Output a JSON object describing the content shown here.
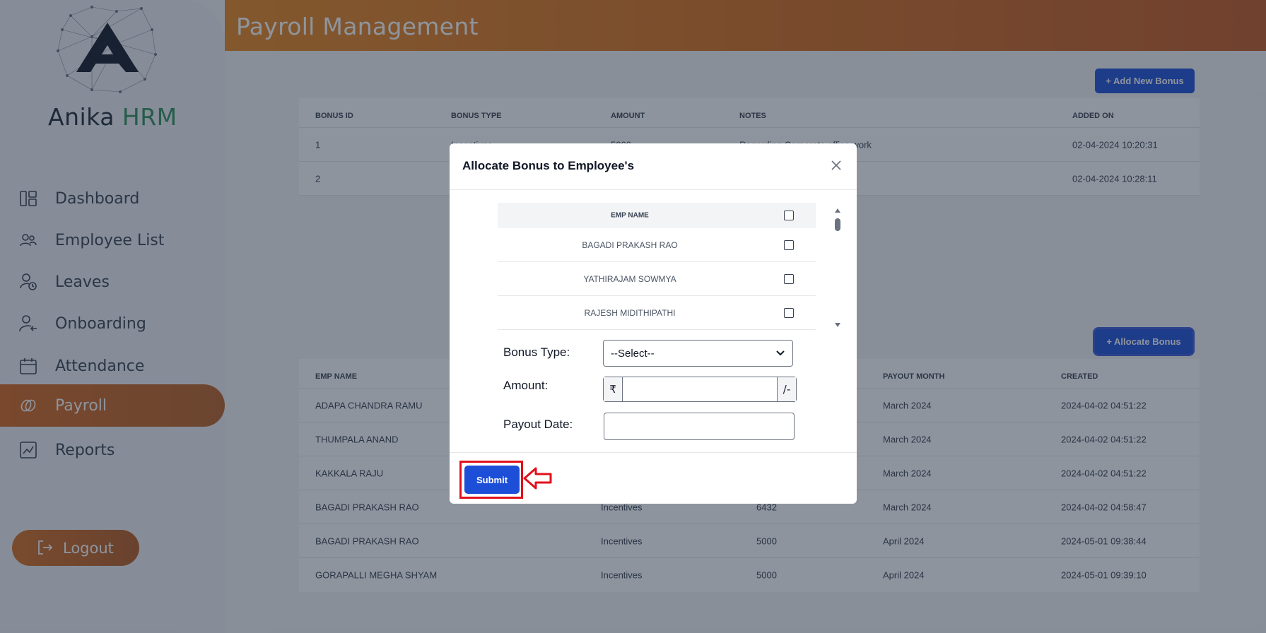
{
  "sidebar": {
    "brand_part1": "Anika",
    "brand_part2": "HRM",
    "items": [
      {
        "label": "Dashboard",
        "icon": "dashboard-icon"
      },
      {
        "label": "Employee List",
        "icon": "users-icon"
      },
      {
        "label": "Leaves",
        "icon": "user-clock-icon"
      },
      {
        "label": "Onboarding",
        "icon": "user-arrow-icon"
      },
      {
        "label": "Attendance",
        "icon": "calendar-icon"
      },
      {
        "label": "Payroll",
        "icon": "money-icon",
        "active": true
      },
      {
        "label": "Reports",
        "icon": "chart-icon"
      }
    ],
    "logout_label": "Logout"
  },
  "header": {
    "title": "Payroll Management"
  },
  "bonus_section": {
    "add_button": "+ Add New Bonus",
    "columns": [
      "BONUS ID",
      "BONUS TYPE",
      "AMOUNT",
      "NOTES",
      "ADDED ON"
    ],
    "rows": [
      [
        "1",
        "Incentives",
        "5000",
        "Regarding Corporate office work",
        "02-04-2024 10:20:31"
      ],
      [
        "2",
        "",
        "",
        "",
        "02-04-2024 10:28:11"
      ]
    ]
  },
  "allocation_section": {
    "allocate_button": "+ Allocate Bonus",
    "columns": [
      "EMP NAME",
      "",
      "",
      "PAYOUT MONTH",
      "CREATED"
    ],
    "rows": [
      [
        "ADAPA CHANDRA RAMU",
        "",
        "",
        "March 2024",
        "2024-04-02 04:51:22"
      ],
      [
        "THUMPALA ANAND",
        "",
        "",
        "March 2024",
        "2024-04-02 04:51:22"
      ],
      [
        "KAKKALA RAJU",
        "",
        "",
        "March 2024",
        "2024-04-02 04:51:22"
      ],
      [
        "BAGADI PRAKASH RAO",
        "Incentives",
        "6432",
        "March 2024",
        "2024-04-02 04:58:47"
      ],
      [
        "BAGADI PRAKASH RAO",
        "Incentives",
        "5000",
        "April 2024",
        "2024-05-01 09:38:44"
      ],
      [
        "GORAPALLI MEGHA SHYAM",
        "Incentives",
        "5000",
        "April 2024",
        "2024-05-01 09:39:10"
      ]
    ]
  },
  "modal": {
    "title": "Allocate Bonus to Employee's",
    "emp_header": "EMP NAME",
    "employees": [
      "BAGADI PRAKASH RAO",
      "YATHIRAJAM SOWMYA",
      "RAJESH MIDITHIPATHI"
    ],
    "bonus_type_label": "Bonus Type:",
    "bonus_type_value": "--Select--",
    "amount_label": "Amount:",
    "currency_symbol": "₹",
    "amount_suffix": "/-",
    "amount_value": "",
    "payout_date_label": "Payout Date:",
    "payout_date_value": "",
    "submit_label": "Submit"
  },
  "colors": {
    "accent": "#d5671f",
    "primary_button": "#1d4ed8",
    "highlight": "#e0111b",
    "brand_green": "#2f8f5b"
  }
}
